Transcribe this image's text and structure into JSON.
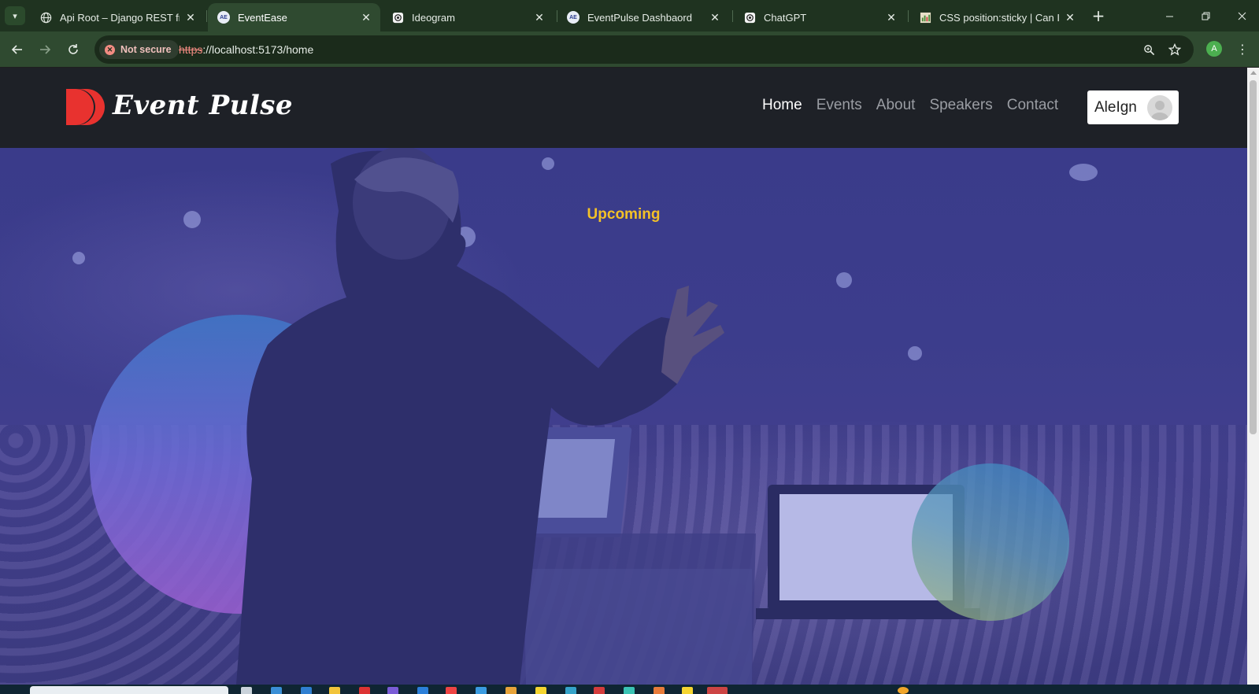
{
  "browser": {
    "tabs": [
      {
        "title": "Api Root – Django REST fram",
        "favicon": "globe-icon",
        "active": false
      },
      {
        "title": "EventEase",
        "favicon": "ae-logo-icon",
        "active": true
      },
      {
        "title": "Ideogram",
        "favicon": "openai-knot-icon",
        "active": false
      },
      {
        "title": "EventPulse Dashbaord",
        "favicon": "ae-logo-icon",
        "active": false
      },
      {
        "title": "ChatGPT",
        "favicon": "openai-knot-icon",
        "active": false
      },
      {
        "title": "CSS position:sticky | Can I us",
        "favicon": "caniuse-icon",
        "active": false
      }
    ],
    "favicon_text": "AE",
    "security_label": "Not secure",
    "url_scheme": "https",
    "url_rest": "://localhost:5173/home",
    "profile_initial": "A",
    "colors": {
      "chrome_bg": "#1f3320",
      "toolbar_bg": "#2f4a30"
    }
  },
  "site": {
    "logo_text": "Event Pulse",
    "nav": [
      {
        "label": "Home",
        "current": true
      },
      {
        "label": "Events",
        "current": false
      },
      {
        "label": "About",
        "current": false
      },
      {
        "label": "Speakers",
        "current": false
      },
      {
        "label": "Contact",
        "current": false
      }
    ],
    "user_name": "AleIgn",
    "hero_heading": "Upcoming",
    "colors": {
      "brand_red": "#e8322f",
      "heading_yellow": "#f3c127",
      "header_bg": "#1e2127",
      "hero_overlay": "#3a3b8a"
    }
  }
}
